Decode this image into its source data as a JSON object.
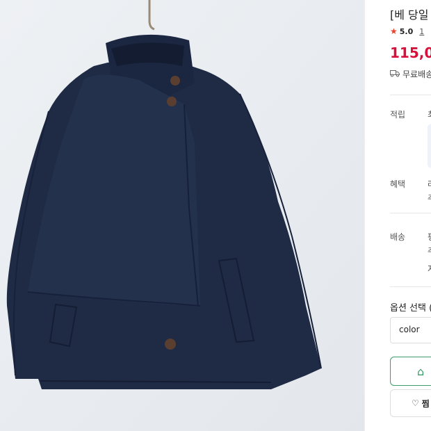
{
  "product": {
    "title": "[베 당일",
    "rating": "5.0",
    "review_count": "1",
    "price": "115,0",
    "shipping": "무료배송"
  },
  "rows": {
    "points_label": "적립",
    "points_value": "최",
    "benefit_label": "혜택",
    "benefit_value_1": "라",
    "benefit_value_2": "추",
    "delivery_label": "배송",
    "delivery_value_1": "평",
    "delivery_value_2": "추",
    "delivery_value_3": "지"
  },
  "options": {
    "title": "옵션 선택 (",
    "select_value": "color"
  },
  "buttons": {
    "wish_label": "찜"
  },
  "icons": {
    "star": "star-icon",
    "truck": "truck-icon",
    "cart": "shopping-bag-icon",
    "heart": "heart-icon"
  },
  "colors": {
    "price": "#d6113c",
    "star": "#e8412c",
    "cart_border": "#3c9d6a",
    "jacket": "#1e2a44"
  }
}
